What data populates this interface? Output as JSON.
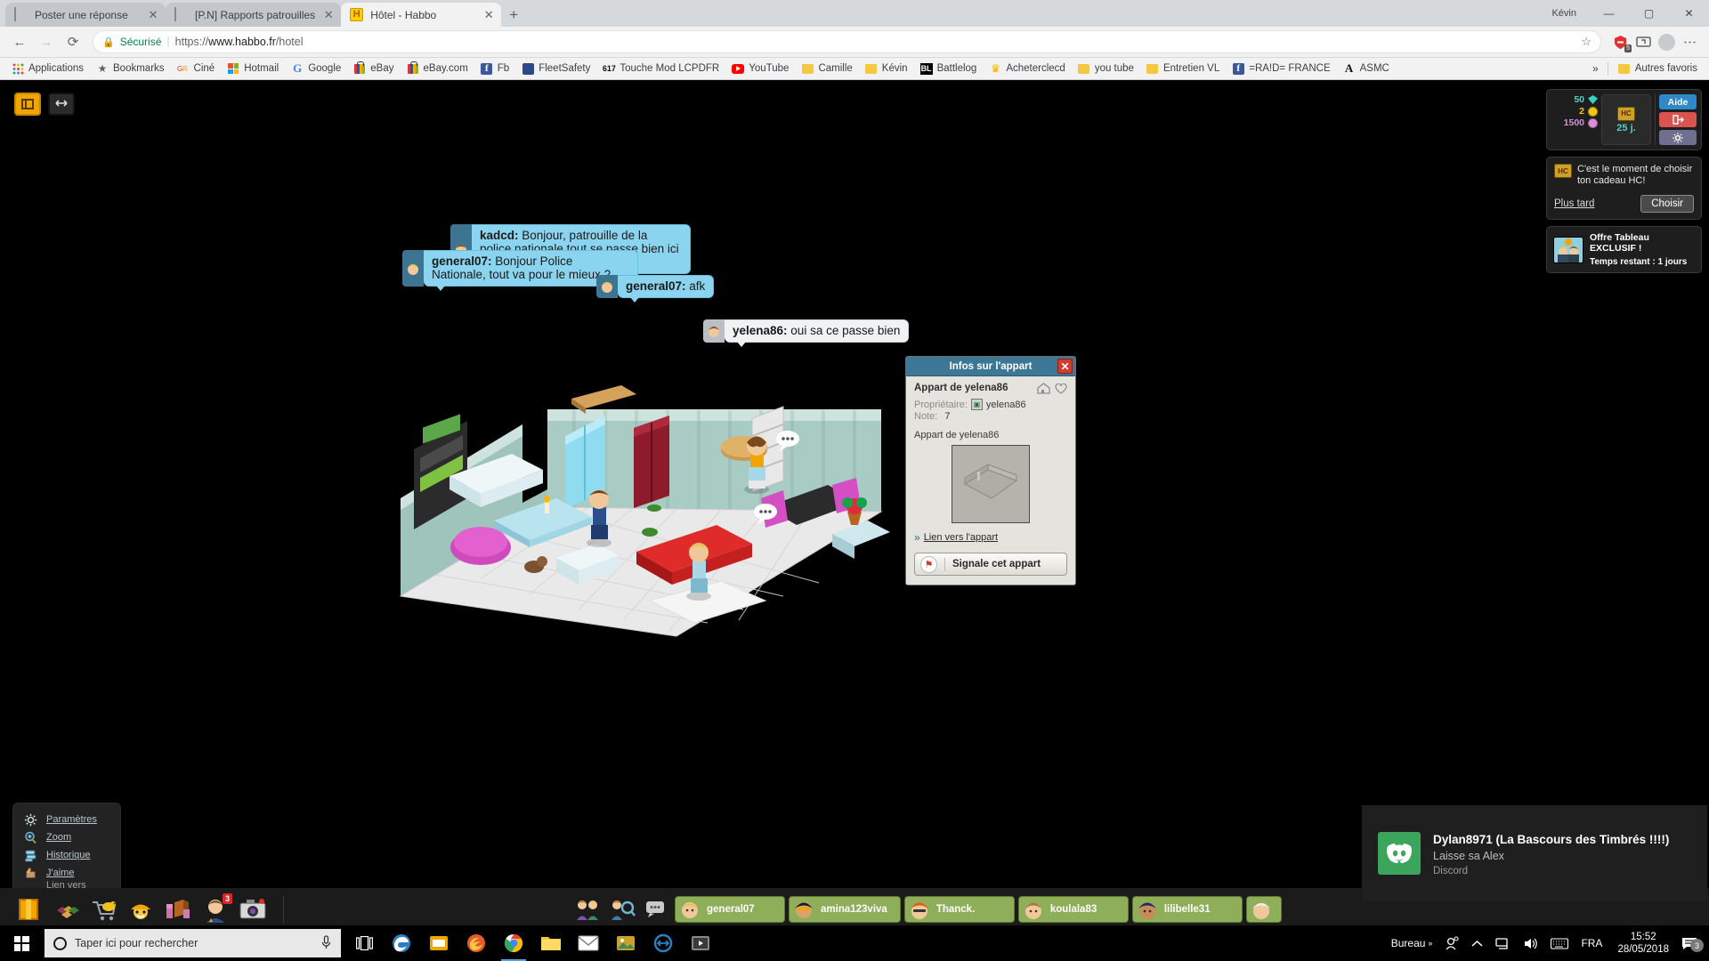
{
  "browser": {
    "tabs": [
      {
        "title": "Poster une réponse",
        "favicon": "flag-fr-icon",
        "active": false
      },
      {
        "title": "[P.N] Rapports patrouilles",
        "favicon": "flag-fr-icon",
        "active": false
      },
      {
        "title": "Hôtel - Habbo",
        "favicon": "habbo-icon",
        "active": true
      }
    ],
    "new_tab_label": "+",
    "window_user": "Kévin",
    "window_controls": {
      "minimize": "—",
      "maximize": "▢",
      "close": "✕"
    },
    "omnibox": {
      "secure_label": "Sécurisé",
      "url_scheme": "https://",
      "url_host": "www.habbo.fr",
      "url_path": "/hotel",
      "lock_icon": "lock-icon",
      "star_icon": "star-icon"
    },
    "extensions": [
      {
        "name": "adblock-extension-icon",
        "badge": "5"
      },
      {
        "name": "screencast-extension-icon",
        "badge": ""
      }
    ],
    "menu_icon": "kebab-menu-icon",
    "bookmarks": [
      {
        "label": "Applications",
        "icon": "apps-grid-icon"
      },
      {
        "label": "Bookmarks",
        "icon": "star-icon"
      },
      {
        "label": "Ciné",
        "icon": "gr-icon"
      },
      {
        "label": "Hotmail",
        "icon": "microsoft-icon"
      },
      {
        "label": "Google",
        "icon": "google-g-icon"
      },
      {
        "label": "eBay",
        "icon": "ebay-bag-icon"
      },
      {
        "label": "eBay.com",
        "icon": "ebay-bag-icon"
      },
      {
        "label": "Fb",
        "icon": "facebook-icon"
      },
      {
        "label": "FleetSafety",
        "icon": "fleetsafety-icon"
      },
      {
        "label": "Touche Mod LCPDFR",
        "icon": "617-icon"
      },
      {
        "label": "YouTube",
        "icon": "youtube-icon"
      },
      {
        "label": "Camille",
        "icon": "folder-icon"
      },
      {
        "label": "Kévin",
        "icon": "folder-icon"
      },
      {
        "label": "Battlelog",
        "icon": "battlelog-icon"
      },
      {
        "label": "Acheterclecd",
        "icon": "crown-icon"
      },
      {
        "label": "you tube",
        "icon": "folder-icon"
      },
      {
        "label": "Entretien VL",
        "icon": "folder-icon"
      },
      {
        "label": "=RA!D= FRANCE",
        "icon": "facebook-icon"
      },
      {
        "label": "ASMC",
        "icon": "asmc-icon"
      }
    ],
    "bookmarks_overflow": "»",
    "other_bookmarks": {
      "label": "Autres favoris",
      "icon": "folder-icon"
    }
  },
  "game": {
    "toolbar_buttons": [
      {
        "name": "fullscreen-toggle-button",
        "icon": "window-icon"
      },
      {
        "name": "expand-toggle-button",
        "icon": "arrows-icon"
      }
    ],
    "chat_bubbles": [
      {
        "user": "kadcd:",
        "text": " Bonjour, patrouille de la police nationale tout se passe bien ici ?",
        "style": "blue",
        "avatar": "avatar-head-icon"
      },
      {
        "user": "general07:",
        "text": " Bonjour Police Nationale, tout va pour le mieux ?",
        "style": "blue",
        "avatar": "avatar-head-icon"
      },
      {
        "user": "general07:",
        "text": " afk",
        "style": "blue",
        "avatar": "avatar-head-icon"
      },
      {
        "user": "yelena86:",
        "text": " oui sa ce passe bien",
        "style": "white",
        "avatar": "avatar-head-icon"
      }
    ],
    "info_window": {
      "title": "Infos sur l'appart",
      "close_icon": "close-icon",
      "room_name": "Appart de yelena86",
      "owner_label": "Propriétaire:",
      "owner_value": "yelena86",
      "owner_badge_icon": "badge-icon",
      "rating_label": "Note:",
      "rating_value": "7",
      "thumb_caption": "Appart de yelena86",
      "thumbnail_icon": "room-preview-icon",
      "link_label": "Lien vers l'appart",
      "link_icon": "chevrons-right-icon",
      "report_label": "Signale cet appart",
      "report_icon": "flag-icon",
      "home_icon": "house-icon",
      "favorite_icon": "heart-icon"
    },
    "hud": {
      "currencies": [
        {
          "value": "50",
          "icon": "diamond-icon",
          "type": "diamond"
        },
        {
          "value": "2",
          "icon": "coin-icon",
          "type": "coin"
        },
        {
          "value": "1500",
          "icon": "duckets-icon",
          "type": "duck"
        }
      ],
      "hc": {
        "icon": "hc-icon",
        "days": "25 j."
      },
      "buttons": [
        {
          "label": "Aide",
          "name": "help-button",
          "icon": ""
        },
        {
          "label": "",
          "name": "logout-button",
          "icon": "exit-icon"
        },
        {
          "label": "",
          "name": "settings-button",
          "icon": "gear-icon"
        }
      ],
      "promo": {
        "icon": "hc-icon",
        "text": "C'est le moment de choisir ton cadeau HC!",
        "later_label": "Plus tard",
        "choose_label": "Choisir"
      },
      "offer": {
        "title": "Offre Tableau EXCLUSIF !",
        "subtitle": "Temps restant : 1 jours",
        "icon": "offer-thumbnail-icon"
      }
    },
    "context_menu": {
      "items": [
        {
          "label": "Paramètres",
          "icon": "gear-icon",
          "underlined": true
        },
        {
          "label": "Zoom",
          "icon": "magnifier-plus-icon",
          "underlined": true
        },
        {
          "label": "Historique",
          "icon": "chat-history-icon",
          "underlined": true
        },
        {
          "label": "J'aime",
          "icon": "thumbs-up-icon",
          "underlined": true
        },
        {
          "label": "Lien vers l'appar",
          "icon": "chevrons-right-icon",
          "underlined": false
        }
      ],
      "prev_icon": "chevron-left-icon",
      "next_icon": "chevron-right-icon",
      "selected_icon": "furni-icon"
    },
    "chat_input": {
      "value": "",
      "placeholder": "",
      "style_icon": "bubble-style-icon",
      "caret_icon": "chevron-down-icon"
    },
    "bottom_bar": {
      "nav_icons": [
        {
          "name": "habbo-home-icon",
          "badge": ""
        },
        {
          "name": "inventory-icon",
          "badge": ""
        },
        {
          "name": "catalog-icon",
          "badge": ""
        },
        {
          "name": "builders-club-icon",
          "badge": ""
        },
        {
          "name": "room-builder-icon",
          "badge": ""
        },
        {
          "name": "profile-icon",
          "badge": "3"
        },
        {
          "name": "camera-icon",
          "badge": ""
        }
      ],
      "center_icons": [
        {
          "name": "friends-icon"
        },
        {
          "name": "search-friends-icon"
        },
        {
          "name": "chat-icon"
        }
      ],
      "user_chips": [
        {
          "name": "general07",
          "avatar": "avatar-head-icon"
        },
        {
          "name": "amina123viva",
          "avatar": "avatar-head-icon"
        },
        {
          "name": "Thanck.",
          "avatar": "avatar-head-icon"
        },
        {
          "name": "koulala83",
          "avatar": "avatar-head-icon"
        },
        {
          "name": "lilibelle31",
          "avatar": "avatar-head-icon"
        },
        {
          "name": "",
          "avatar": "avatar-head-icon"
        }
      ]
    },
    "toast": {
      "title": "Dylan8971 (La Bascours des Timbrés !!!!)",
      "message": "Laisse sa Alex",
      "app": "Discord",
      "icon": "discord-icon"
    }
  },
  "taskbar": {
    "start_icon": "windows-start-icon",
    "search_placeholder": "Taper ici pour rechercher",
    "search_icon": "cortana-circle-icon",
    "mic_icon": "microphone-icon",
    "taskview_icon": "task-view-icon",
    "pinned": [
      {
        "name": "edge-icon"
      },
      {
        "name": "store-icon"
      },
      {
        "name": "firefox-icon"
      },
      {
        "name": "chrome-icon",
        "active": true
      },
      {
        "name": "file-explorer-icon"
      },
      {
        "name": "mail-icon"
      },
      {
        "name": "photos-icon"
      },
      {
        "name": "teamviewer-icon"
      },
      {
        "name": "media-player-icon"
      }
    ],
    "tray": {
      "desktop_label": "Bureau",
      "overflow_icon": "chevron-up-icon",
      "people_icon": "people-icon",
      "network_icon": "network-icon",
      "volume_icon": "volume-icon",
      "keyboard_icon": "keyboard-icon",
      "language": "FRA",
      "time": "15:52",
      "date": "28/05/2018",
      "action_center_icon": "action-center-icon",
      "notification_count": "3"
    }
  }
}
